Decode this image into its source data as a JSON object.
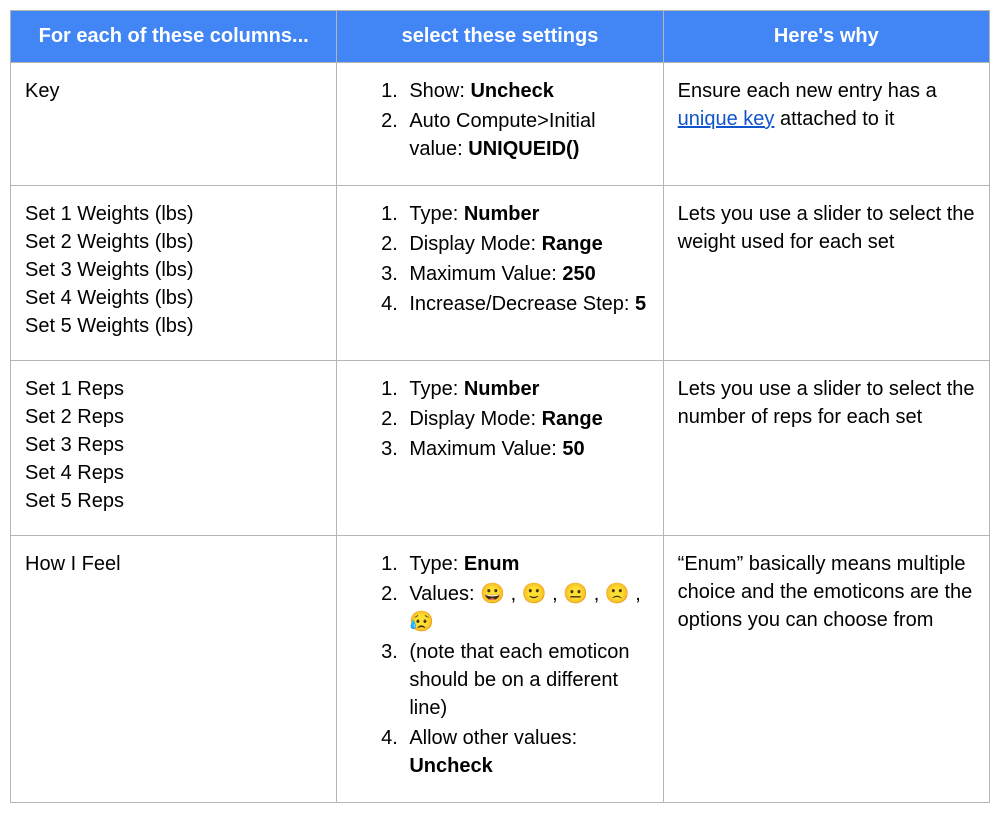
{
  "headers": {
    "col_columns": "For each of these columns...",
    "col_settings": "select these settings",
    "col_why": "Here's why"
  },
  "rows": [
    {
      "columns": [
        "Key"
      ],
      "settings": [
        {
          "label": "Show: ",
          "bold": "Uncheck",
          "tail": ""
        },
        {
          "label": "Auto Compute>Initial value: ",
          "bold": "UNIQUEID()",
          "tail": ""
        }
      ],
      "why_parts": {
        "pre": "Ensure each new entry has a ",
        "link_text": "unique key",
        "post": " attached to it"
      }
    },
    {
      "columns": [
        "Set 1 Weights (lbs)",
        "Set 2 Weights (lbs)",
        "Set 3 Weights (lbs)",
        "Set 4 Weights (lbs)",
        "Set 5 Weights (lbs)"
      ],
      "settings": [
        {
          "label": "Type: ",
          "bold": "Number",
          "tail": ""
        },
        {
          "label": "Display Mode: ",
          "bold": "Range",
          "tail": ""
        },
        {
          "label": "Maximum Value: ",
          "bold": "250",
          "tail": ""
        },
        {
          "label": "Increase/Decrease Step: ",
          "bold": "5",
          "tail": ""
        }
      ],
      "why": "Lets you use a slider to select the weight used for each set"
    },
    {
      "columns": [
        "Set 1 Reps",
        "Set 2 Reps",
        "Set 3 Reps",
        "Set 4 Reps",
        "Set 5 Reps"
      ],
      "settings": [
        {
          "label": "Type: ",
          "bold": "Number",
          "tail": ""
        },
        {
          "label": "Display Mode: ",
          "bold": "Range",
          "tail": ""
        },
        {
          "label": "Maximum Value: ",
          "bold": "50",
          "tail": ""
        }
      ],
      "why": "Lets you use a slider to select the number of reps for each set"
    },
    {
      "columns": [
        "How I Feel"
      ],
      "settings": [
        {
          "label": "Type: ",
          "bold": "Enum",
          "tail": ""
        },
        {
          "label": "Values: 😀 , 🙂 , 😐 , 🙁 , 😥",
          "bold": "",
          "tail": ""
        },
        {
          "label": "(note that each emoticon should be on a different line)",
          "bold": "",
          "tail": ""
        },
        {
          "label": "Allow other values: ",
          "bold": "Uncheck",
          "tail": ""
        }
      ],
      "why": "“Enum” basically means multiple choice and the emoticons are the options you can choose from"
    }
  ]
}
